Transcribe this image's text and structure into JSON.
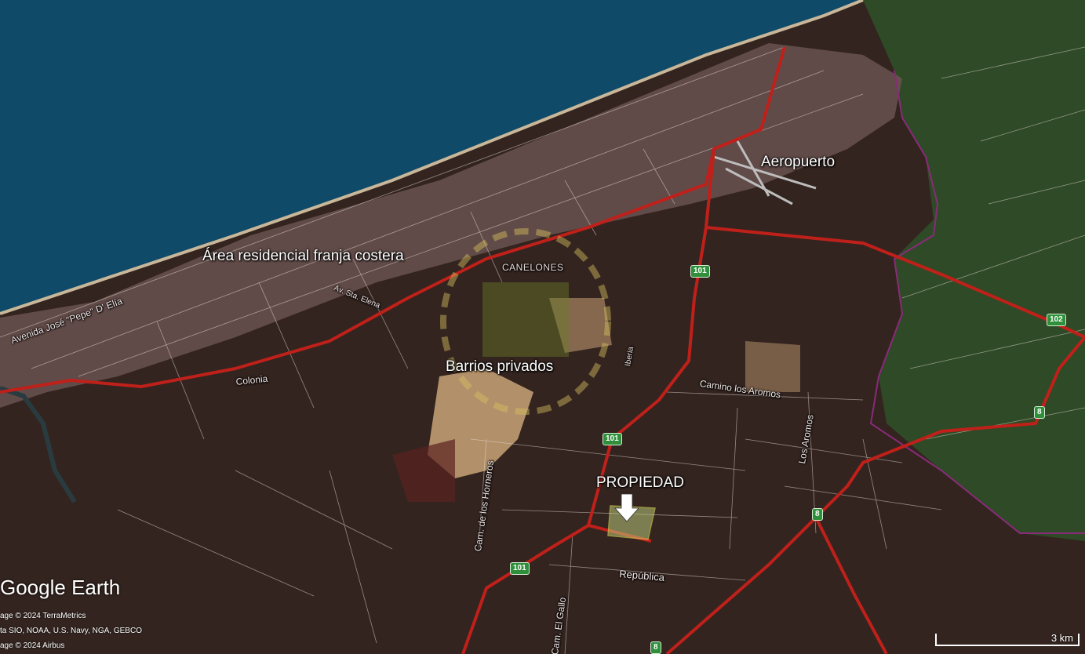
{
  "labels": {
    "aeropuerto": "Aeropuerto",
    "area_residencial": "Área residencial franja costera",
    "barrios_privados": "Barrios privados",
    "propiedad": "PROPIEDAD"
  },
  "streets": {
    "avenida_jose": "Avenida José \"Pepe\" D' Elía",
    "av_sta_elena": "Av. Sta. Elena",
    "colonia": "Colonia",
    "camino_los_aromos": "Camino los Aromos",
    "los_aromos": "Los Aromos",
    "cam_los_horneros": "Cam. de los Horneros",
    "cam_el_gallo": "Cam. El Gallo",
    "republica": "República",
    "iberia": "Iberia"
  },
  "towns": {
    "canelones": "CANELONES"
  },
  "route_shields": {
    "r101_a": "101",
    "r101_b": "101",
    "r101_c": "101",
    "r102": "102",
    "r8_a": "8",
    "r8_b": "8",
    "r8_c": "8"
  },
  "attribution": {
    "brand": "Google Earth",
    "credit1": "age © 2024 TerraMetrics",
    "credit2": "ta SIO, NOAA, U.S. Navy, NGA, GEBCO",
    "credit3": "age © 2024 Airbus"
  },
  "scale_bar": {
    "label": "3 km"
  },
  "colors": {
    "ocean": "#0f4a68",
    "urban": "#6a5250",
    "land_dark": "#3a2a26",
    "farmland": "#2f4a26",
    "route": "#c0201a",
    "property_outline": "#f0f060"
  }
}
